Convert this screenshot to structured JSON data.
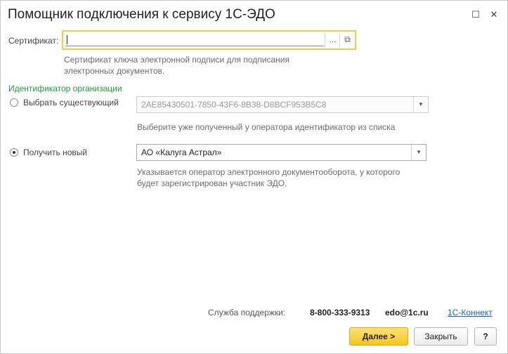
{
  "window": {
    "title": "Помощник подключения к сервису 1С-ЭДО",
    "maximize_glyph": "☐",
    "close_glyph": "✕"
  },
  "certificate": {
    "label": "Сертификат:",
    "value": "",
    "select_glyph": "...",
    "open_glyph": "⧉",
    "hint_line1": "Сертификат ключа электронной подписи для подписания",
    "hint_line2": "электронных документов."
  },
  "org_id": {
    "section_label": "Идентификатор организации",
    "existing": {
      "label": "Выбрать существующий",
      "selected": false,
      "value": "2AE85430501-7850-43F6-8B38-D8BCF953B5C8",
      "hint": "Выберите уже полученный у оператора идентификатор из списка"
    },
    "new": {
      "label": "Получить новый",
      "selected": true,
      "value": "АО «Калуга Астрал»",
      "hint_line1": "Указывается оператор электронного документооборота, у которого",
      "hint_line2": "будет зарегистрирован участник ЭДО."
    }
  },
  "support": {
    "label": "Служба поддержки:",
    "phone": "8-800-333-9313",
    "email": "edo@1c.ru",
    "link": "1С-Коннект"
  },
  "buttons": {
    "next": "Далее >",
    "close": "Закрыть",
    "help": "?"
  },
  "colors": {
    "accent_yellow": "#f4c520",
    "section_green": "#1e9c3a",
    "link_blue": "#1f5fbf",
    "error_red": "#e06a6a"
  }
}
